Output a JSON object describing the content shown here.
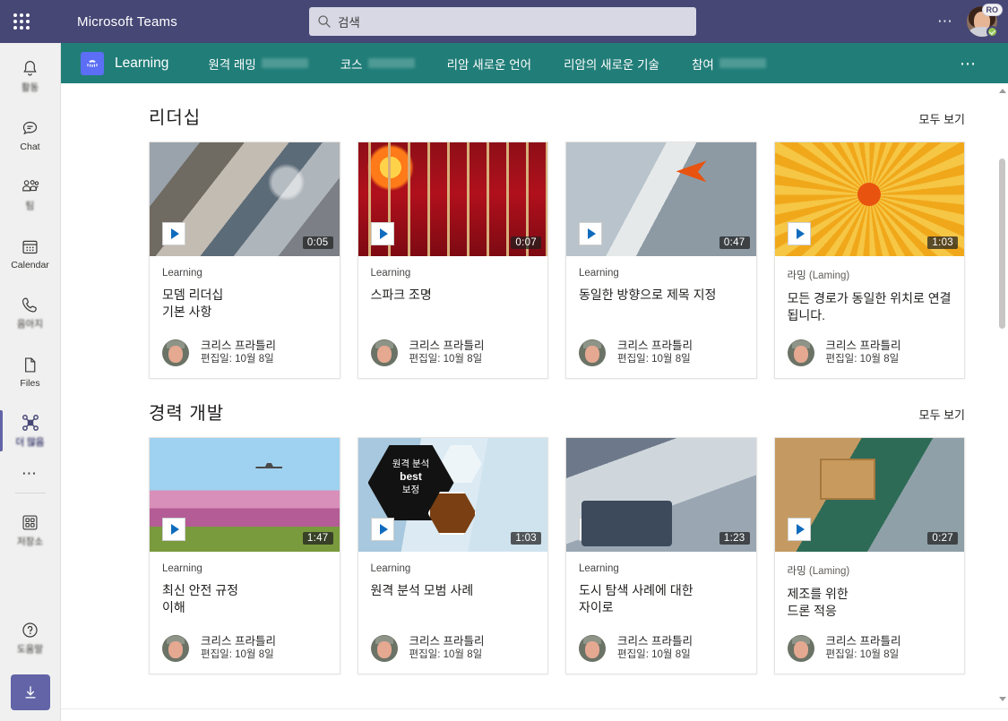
{
  "titlebar": {
    "waffle_icon": "app-launcher-icon",
    "app_title": "Microsoft Teams",
    "search": {
      "icon": "search-icon",
      "placeholder": "검색",
      "value": ""
    },
    "more_icon": "ellipsis-icon",
    "avatar": {
      "name": "avatar",
      "badge": "RO",
      "presence": "available"
    }
  },
  "rail": {
    "items": [
      {
        "label": "활동",
        "icon": "bell-icon",
        "active": false,
        "blurred": true
      },
      {
        "label": "Chat",
        "icon": "chat-icon",
        "active": false,
        "blurred": false
      },
      {
        "label": "팀",
        "icon": "teams-icon",
        "active": false,
        "blurred": true
      },
      {
        "label": "Calendar",
        "icon": "calendar-icon",
        "active": false,
        "blurred": false
      },
      {
        "label": "음아지",
        "icon": "calls-icon",
        "active": false,
        "blurred": true
      },
      {
        "label": "Files",
        "icon": "files-icon",
        "active": false,
        "blurred": false
      },
      {
        "label": "더 많음",
        "icon": "drone-app-icon",
        "active": true,
        "blurred": true
      }
    ],
    "more_icon": "ellipsis-icon",
    "store": {
      "label": "저장소",
      "icon": "store-icon"
    },
    "help": {
      "label": "도움말",
      "icon": "help-icon"
    },
    "download": {
      "icon": "download-icon"
    }
  },
  "appbar": {
    "icon": "learning-app-icon",
    "name": "Learning",
    "tabs": [
      {
        "label": "원격 래밍",
        "has_blur": true
      },
      {
        "label": "코스",
        "has_blur": true
      },
      {
        "label": "리암 새로운 언어",
        "has_blur": false
      },
      {
        "label": "리암의 새로운 기술",
        "has_blur": false
      },
      {
        "label": "참여",
        "has_blur": true
      }
    ],
    "more_icon": "ellipsis-icon"
  },
  "sections": [
    {
      "title": "리더십",
      "view_all": "모두 보기",
      "cards": [
        {
          "provider": "Learning",
          "provider_paren": "",
          "title_line1": "모뎀 리더십",
          "title_line2": "기본 사항",
          "duration": "0:05",
          "author": "크리스 프라틀리",
          "edited": "편집일: 10월 8일",
          "thumb_class": "th1",
          "play_icon": "play-icon"
        },
        {
          "provider": "Learning",
          "provider_paren": "",
          "title_line1": "스파크 조명",
          "title_line2": "",
          "duration": "0:07",
          "author": "크리스 프라틀리",
          "edited": "편집일: 10월 8일",
          "thumb_class": "th2",
          "play_icon": "play-icon"
        },
        {
          "provider": "Learning",
          "provider_paren": "",
          "title_line1": "동일한 방향으로 제목 지정",
          "title_line2": "",
          "duration": "0:47",
          "author": "크리스 프라틀리",
          "edited": "편집일: 10월 8일",
          "thumb_class": "th3",
          "play_icon": "play-icon"
        },
        {
          "provider": "라밍",
          "provider_paren": "(Laming)",
          "title_line1": "모든 경로가 동일한 위치로 연결됩니다.",
          "title_line2": "",
          "duration": "1:03",
          "author": "크리스 프라틀리",
          "edited": "편집일: 10월 8일",
          "thumb_class": "th4",
          "play_icon": "play-icon"
        }
      ]
    },
    {
      "title": "경력 개발",
      "view_all": "모두 보기",
      "cards": [
        {
          "provider": "Learning",
          "provider_paren": "",
          "title_line1": "최신 안전 규정",
          "title_line2": "이해",
          "duration": "1:47",
          "author": "크리스 프라틀리",
          "edited": "편집일: 10월 8일",
          "thumb_class": "th5",
          "play_icon": "play-icon"
        },
        {
          "provider": "Learning",
          "provider_paren": "",
          "title_line1": "원격 분석 모범 사례",
          "title_line2": "",
          "duration": "1:03",
          "author": "크리스 프라틀리",
          "edited": "편집일: 10월 8일",
          "thumb_class": "th6",
          "play_icon": "play-icon",
          "overlay": {
            "line1": "원격 분석",
            "line2": "best",
            "line3": "보정"
          }
        },
        {
          "provider": "Learning",
          "provider_paren": "",
          "title_line1": "도시 탐색 사례에 대한",
          "title_line2": "자이로",
          "duration": "1:23",
          "author": "크리스 프라틀리",
          "edited": "편집일: 10월 8일",
          "thumb_class": "th7",
          "play_icon": "play-icon"
        },
        {
          "provider": "라밍",
          "provider_paren": "(Laming)",
          "title_line1": "제조를 위한",
          "title_line2": "드론 적응",
          "duration": "0:27",
          "author": "크리스 프라틀리",
          "edited": "편집일: 10월 8일",
          "thumb_class": "th8",
          "play_icon": "play-icon"
        }
      ]
    }
  ],
  "colors": {
    "titlebar": "#464775",
    "appbar_teal": "#217d78",
    "accent_purple": "#6264a7",
    "rail_bg": "#f0f0f0"
  }
}
